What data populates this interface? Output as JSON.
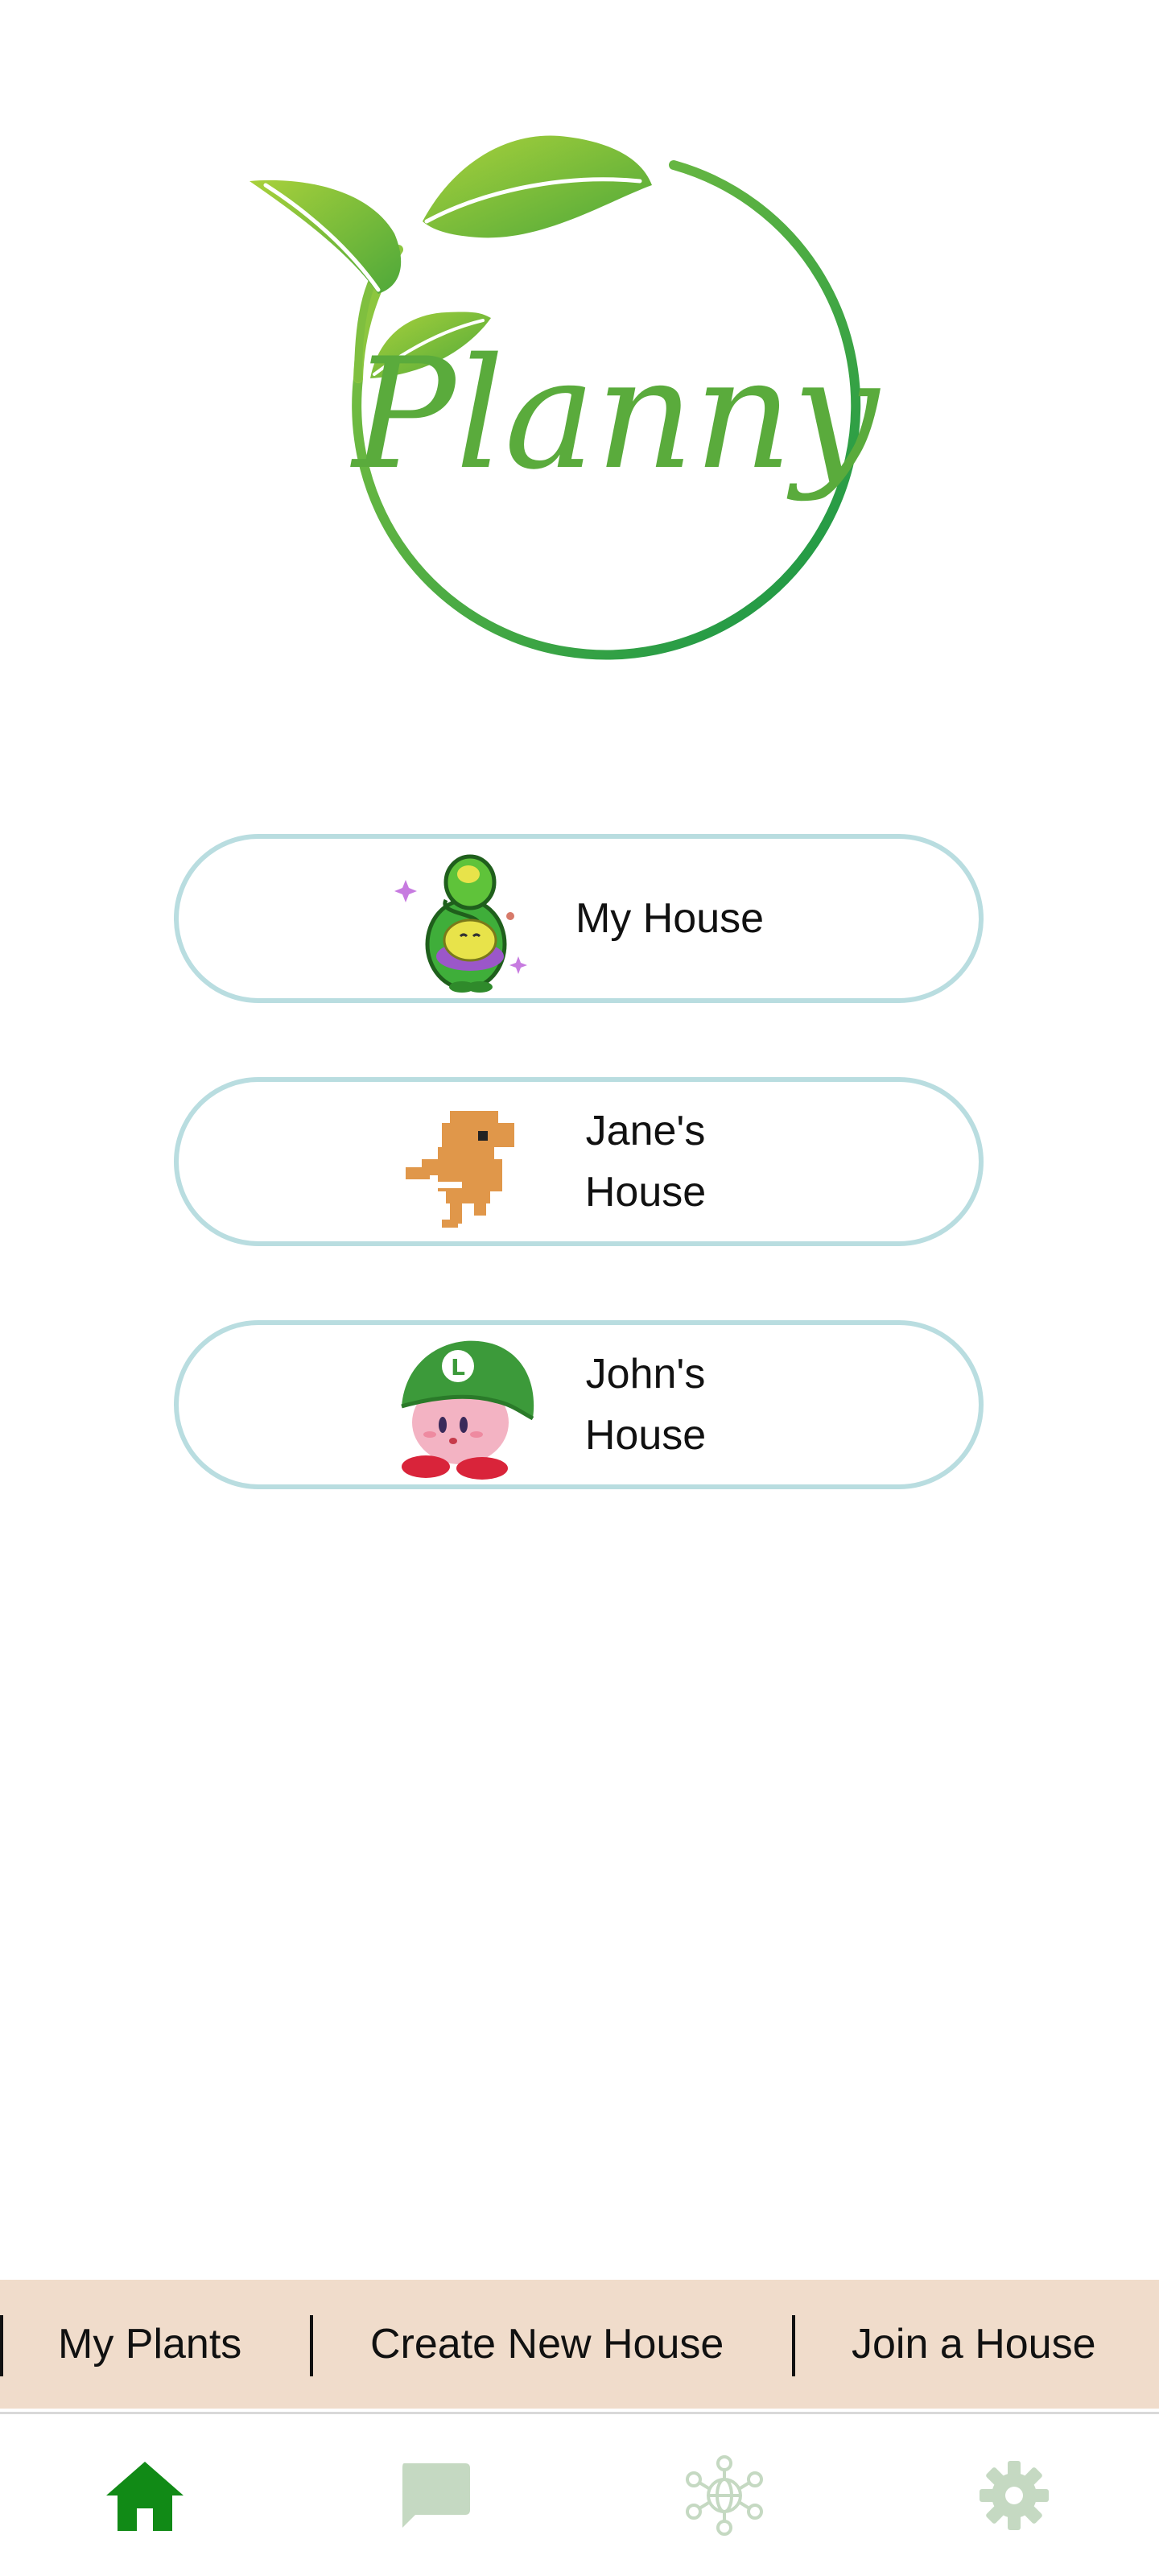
{
  "app": {
    "logo_text": "Planny"
  },
  "houses": [
    {
      "label": "My House",
      "avatar_icon": "sprout-creature-avatar-icon"
    },
    {
      "label": "Jane's House",
      "avatar_icon": "pixel-dinosaur-avatar-icon"
    },
    {
      "label": "John's House",
      "avatar_icon": "pink-puff-green-cap-avatar-icon"
    }
  ],
  "quick_actions": {
    "my_plants": "My Plants",
    "create_new_house": "Create New House",
    "join_a_house": "Join a House"
  },
  "bottom_nav": [
    {
      "icon": "home-icon",
      "active": true
    },
    {
      "icon": "chat-bubble-icon",
      "active": false
    },
    {
      "icon": "community-globe-icon",
      "active": false
    },
    {
      "icon": "gear-icon",
      "active": false
    }
  ],
  "colors": {
    "brand_green": "#5aab3c",
    "button_border": "#b9dde0",
    "quickbar_bg": "#f0dccb",
    "nav_active": "#118a16",
    "nav_inactive": "#c5d9c2"
  }
}
